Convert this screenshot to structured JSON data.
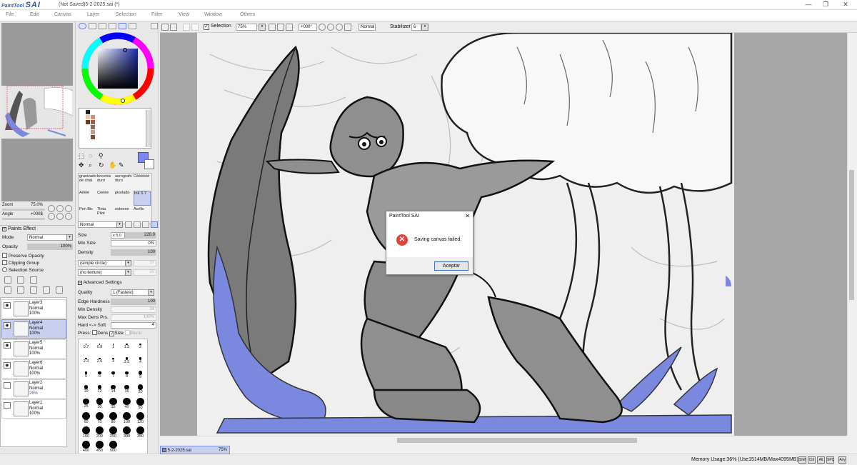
{
  "titlebar": {
    "logo_small": "PaintTool",
    "logo_big": "SAI",
    "title": "(Not Saved)5-2-2025.sai (*)",
    "minimize": "—",
    "restore": "❐",
    "close": "✕"
  },
  "menu": [
    "File",
    "Edit",
    "Canvas",
    "Layer",
    "Selection",
    "Filter",
    "View",
    "Window",
    "Others"
  ],
  "navigator": {
    "zoom_label": "Zoom",
    "zoom_value": "75.0%",
    "angle_label": "Angle",
    "angle_value": "+000$"
  },
  "layer_props": {
    "paints_effect": "Paints Effect",
    "mode_label": "Mode",
    "mode_value": "Normal",
    "opacity_label": "Opacity",
    "opacity_value": "100%",
    "preserve_opacity": "Preserve Opacity",
    "clipping_group": "Clipping Group",
    "selection_source": "Selection Source"
  },
  "layers": [
    {
      "name": "Layer3",
      "mode": "Normal",
      "opacity": "100%",
      "visible": true,
      "selected": false
    },
    {
      "name": "Layer4",
      "mode": "Normal",
      "opacity": "100%",
      "visible": true,
      "selected": true
    },
    {
      "name": "Layer5",
      "mode": "Normal",
      "opacity": "100%",
      "visible": true,
      "selected": false
    },
    {
      "name": "Layer6",
      "mode": "Normal",
      "opacity": "100%",
      "visible": true,
      "selected": false
    },
    {
      "name": "Layer2",
      "mode": "Normal",
      "opacity": "26%",
      "visible": false,
      "selected": false
    },
    {
      "name": "Layer1",
      "mode": "Normal",
      "opacity": "100%",
      "visible": false,
      "selected": false
    }
  ],
  "brushes": [
    "granizado de chat",
    "bocetos duro",
    "aerografo duro",
    "Cèèèèèè",
    "Aèèiè",
    "Cèèèè",
    "pixelado",
    "Ink S 7",
    "Pen Bic",
    "Tinta Pilot",
    "esteeee",
    "Acrilic"
  ],
  "tool_settings": {
    "blend_mode": "Normal",
    "size_label": "Size",
    "size_mult": "x 5.0",
    "size_value": "220.0",
    "minsize_label": "Min Size",
    "minsize_value": "0%",
    "density_label": "Density",
    "density_value": "100",
    "shape": "(simple circle)",
    "shape_val": "50",
    "texture": "(no texture)",
    "texture_val": "95",
    "advanced": "Advanced Settings",
    "quality_label": "Quality",
    "quality_value": "1 (Fastest)",
    "edge_label": "Edge Hardness",
    "edge_value": "100",
    "mindens_label": "Min Density",
    "mindens_value": "19",
    "maxdens_label": "Max Dens Prs.",
    "maxdens_value": "100%",
    "hardsoft_label": "Hard <-> Soft",
    "hardsoft_value": "4",
    "press_label": "Press:",
    "press_dens": "Dens",
    "press_size": "Size",
    "press_blend": "Blend"
  },
  "brush_sizes": [
    "0.7",
    "0.8",
    "1",
    "1.5",
    "2",
    "2.3",
    "2.6",
    "3",
    "3.5",
    "4",
    "5",
    "6",
    "7",
    "8",
    "9",
    "10",
    "12",
    "14",
    "16",
    "20",
    "25",
    "30",
    "35",
    "40",
    "50",
    "60",
    "70",
    "80",
    "100",
    "120",
    "160",
    "200",
    "250",
    "300",
    "350",
    "400",
    "450",
    "500"
  ],
  "toolbar": {
    "selection_label": "Selection",
    "zoom": "75%",
    "angle": "+000°",
    "mode": "Normal",
    "stabilizer_label": "Stabilizer",
    "stabilizer_value": "6"
  },
  "dialog": {
    "title": "PaintTool SAI",
    "close": "✕",
    "message": "Saving canvas failed.",
    "button": "Aceptar"
  },
  "statusbar": {
    "tab_name": "5-2-2025.sai",
    "tab_zoom": "75%",
    "memory": "Memory Usage:36% (Use1514MB/Max4095MB)",
    "keys": [
      "Shift",
      "Ctrl",
      "Alt",
      "SPC",
      "Any"
    ]
  },
  "colors": {
    "accent_blue": "#7a88e0",
    "selection_blue": "#c8d0ee",
    "error_red": "#e0443a"
  }
}
